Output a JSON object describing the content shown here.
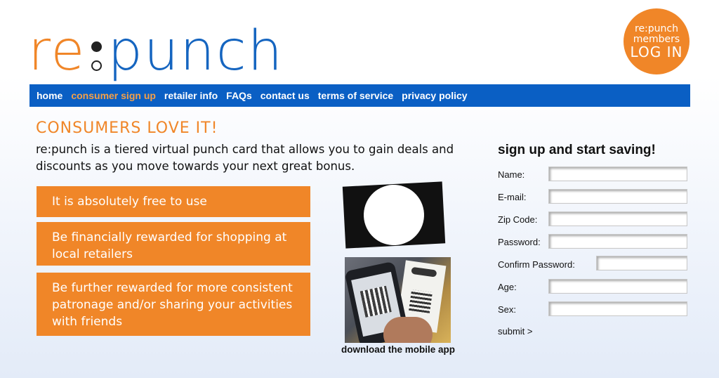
{
  "logo": {
    "re": "re",
    "punch": "punch"
  },
  "login": {
    "line1": "re:punch",
    "line2": "members",
    "line3": "LOG IN"
  },
  "nav": {
    "items": [
      {
        "label": "home",
        "active": false
      },
      {
        "label": "consumer sign up",
        "active": true
      },
      {
        "label": "retailer info",
        "active": false
      },
      {
        "label": "FAQs",
        "active": false
      },
      {
        "label": "contact us",
        "active": false
      },
      {
        "label": "terms of service",
        "active": false
      },
      {
        "label": "privacy policy",
        "active": false
      }
    ]
  },
  "main": {
    "headline": "CONSUMERS LOVE IT!",
    "intro": "re:punch is a tiered virtual punch card that allows you to gain deals and discounts as you move towards your next great bonus.",
    "benefits": [
      "It is absolutely free to use",
      "Be financially rewarded for shopping at local retailers",
      "Be further rewarded for more consistent patronage and/or sharing your activities with friends"
    ],
    "app_caption": "download the mobile app"
  },
  "signup": {
    "title": "sign up and start saving!",
    "fields": [
      {
        "label": "Name:",
        "value": ""
      },
      {
        "label": "E-mail:",
        "value": ""
      },
      {
        "label": "Zip Code:",
        "value": ""
      },
      {
        "label": "Password:",
        "value": ""
      },
      {
        "label": "Confirm Password:",
        "value": ""
      },
      {
        "label": "Age:",
        "value": ""
      },
      {
        "label": "Sex:",
        "value": ""
      }
    ],
    "submit": "submit >"
  },
  "colors": {
    "brand_orange": "#f08628",
    "brand_blue": "#0a5fc4"
  }
}
